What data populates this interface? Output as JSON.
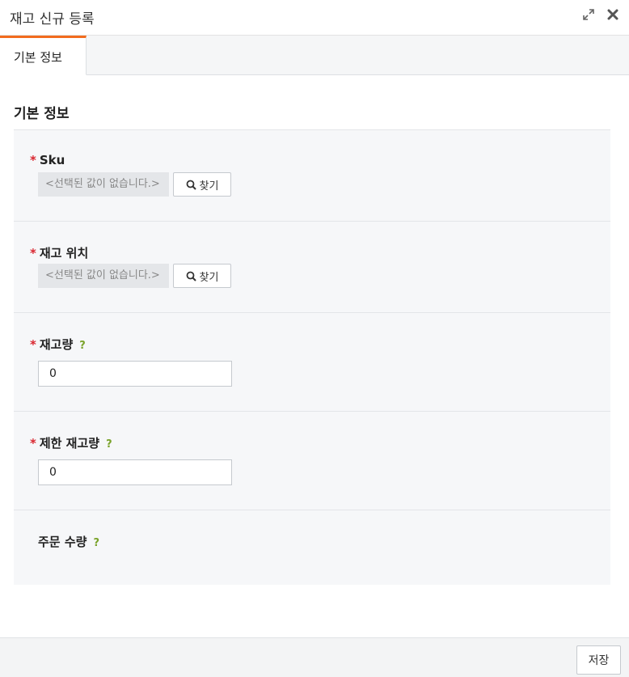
{
  "window": {
    "title": "재고 신규 등록",
    "expand_icon": "expand-icon",
    "close_icon": "close-icon"
  },
  "tabs": [
    {
      "label": "기본 정보",
      "active": true
    }
  ],
  "section": {
    "title": "기본 정보"
  },
  "form": {
    "sku": {
      "required_mark": "*",
      "label": "Sku",
      "value_placeholder": "<선택된 값이 없습니다.>",
      "find_label": "찾기"
    },
    "location": {
      "required_mark": "*",
      "label": "재고 위치",
      "value_placeholder": "<선택된 값이 없습니다.>",
      "find_label": "찾기"
    },
    "quantity": {
      "required_mark": "*",
      "label": "재고량",
      "help": "?",
      "value": "0"
    },
    "limit_quantity": {
      "required_mark": "*",
      "label": "제한 재고량",
      "help": "?",
      "value": "0"
    },
    "order_quantity": {
      "label": "주문 수량",
      "help": "?"
    }
  },
  "footer": {
    "save_label": "저장"
  },
  "colors": {
    "accent": "#f26b1d",
    "required": "#d9262f",
    "help": "#7aa32b"
  }
}
